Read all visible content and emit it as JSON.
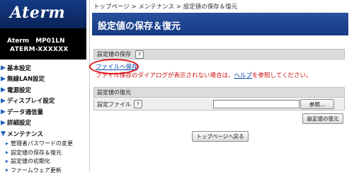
{
  "brand": {
    "logo": "Aterm",
    "model_line1": "Aterm　MP01LN",
    "model_line2": "ATERM-XXXXXX"
  },
  "sidebar": {
    "items": [
      {
        "label": "基本設定"
      },
      {
        "label": "無線LAN設定"
      },
      {
        "label": "電源設定"
      },
      {
        "label": "ディスプレイ設定"
      },
      {
        "label": "データ通信量"
      },
      {
        "label": "詳細設定"
      },
      {
        "label": "メンテナンス"
      }
    ],
    "subitems": [
      {
        "label": "管理者パスワードの変更"
      },
      {
        "label": "設定値の保存＆復元"
      },
      {
        "label": "設定値の初期化"
      },
      {
        "label": "ファームウェア更新"
      }
    ]
  },
  "main": {
    "breadcrumb": "トップページ > メンテナンス > 設定値の保存＆復元",
    "title": "設定値の保存＆復元",
    "save_section": {
      "heading": "設定値の保存",
      "link": "ファイルへ保存",
      "note_prefix": "ファイル保存のダイアログが表示されない場合は、",
      "note_link": "ヘルプ",
      "note_suffix": "を参照してください。"
    },
    "restore_section": {
      "heading": "設定値の復元",
      "file_label": "設定ファイル",
      "browse_button": "参照...",
      "restore_button": "設定値の復元"
    },
    "back_button": "トップページへ戻る",
    "help_glyph": "?"
  },
  "colors": {
    "accent": "#1d3f8a",
    "sidebar_header": "#000000",
    "warning": "#cc1111",
    "highlight_oval": "#e01010"
  }
}
